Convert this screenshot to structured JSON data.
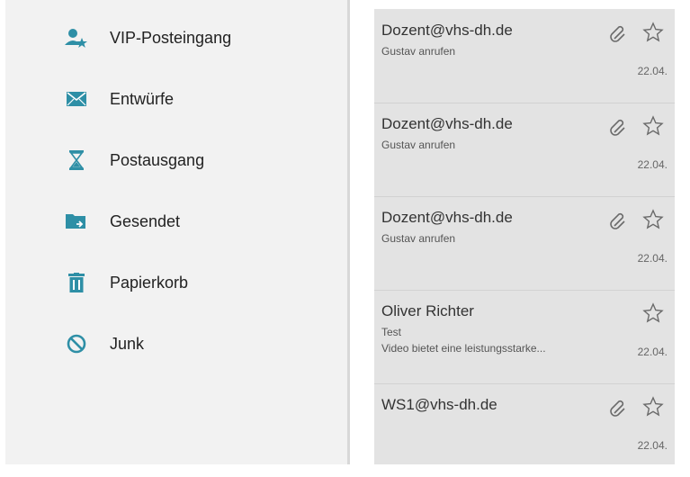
{
  "colors": {
    "accent": "#2e8fa6",
    "sidebar_bg": "#f2f2f2",
    "list_bg": "#e3e3e3"
  },
  "sidebar": {
    "items": [
      {
        "label": "VIP-Posteingang",
        "icon": "vip-user-icon"
      },
      {
        "label": "Entwürfe",
        "icon": "envelope-icon"
      },
      {
        "label": "Postausgang",
        "icon": "hourglass-icon"
      },
      {
        "label": "Gesendet",
        "icon": "sent-folder-icon"
      },
      {
        "label": "Papierkorb",
        "icon": "trash-icon"
      },
      {
        "label": "Junk",
        "icon": "block-icon"
      }
    ]
  },
  "mails": [
    {
      "sender": "Dozent@vhs-dh.de",
      "subject": "Gustav anrufen",
      "preview": "",
      "date": "22.04.",
      "attachment": true
    },
    {
      "sender": "Dozent@vhs-dh.de",
      "subject": "Gustav anrufen",
      "preview": "",
      "date": "22.04.",
      "attachment": true
    },
    {
      "sender": "Dozent@vhs-dh.de",
      "subject": "Gustav anrufen",
      "preview": "",
      "date": "22.04.",
      "attachment": true
    },
    {
      "sender": "Oliver Richter",
      "subject": "Test",
      "preview": "Video bietet eine leistungsstarke...",
      "date": "22.04.",
      "attachment": false
    },
    {
      "sender": "WS1@vhs-dh.de",
      "subject": "",
      "preview": "",
      "date": "22.04.",
      "attachment": true
    }
  ]
}
